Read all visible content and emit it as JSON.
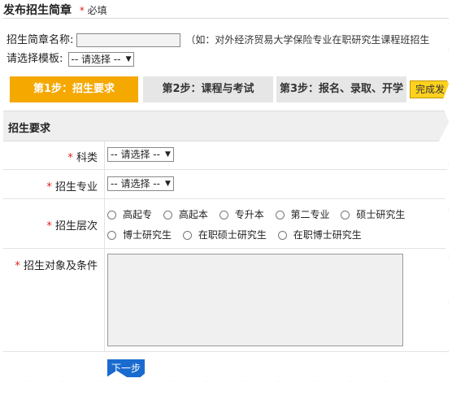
{
  "header": {
    "title": "发布招生简章",
    "required_mark": "*",
    "required_text": "必填"
  },
  "name_field": {
    "label": "招生简章名称:",
    "value": "",
    "hint": "（如：对外经济贸易大学保险专业在职研究生课程班招生"
  },
  "template_field": {
    "label": "请选择模板:",
    "selected": "-- 请选择 --"
  },
  "steps": [
    {
      "label": "第1步：招生要求",
      "active": true
    },
    {
      "label": "第2步：课程与考试",
      "active": false
    },
    {
      "label": "第3步：报名、录取、开学",
      "active": false
    }
  ],
  "finish_button": "完成发",
  "section_title": "招生要求",
  "form": {
    "subject": {
      "label": "科类",
      "selected": "-- 请选择 --"
    },
    "major": {
      "label": "招生专业",
      "selected": "-- 请选择 --"
    },
    "level": {
      "label": "招生层次",
      "options": [
        "高起专",
        "高起本",
        "专升本",
        "第二专业",
        "硕士研究生",
        "博士研究生",
        "在职硕士研究生",
        "在职博士研究生"
      ]
    },
    "conditions": {
      "label": "招生对象及条件",
      "value": ""
    }
  },
  "next_button": "下一步",
  "colors": {
    "step_active": "#f5a800",
    "step_inactive": "#e6e6e6",
    "finish": "#ffd21f",
    "next": "#1a6bd0",
    "required": "#e02020"
  }
}
